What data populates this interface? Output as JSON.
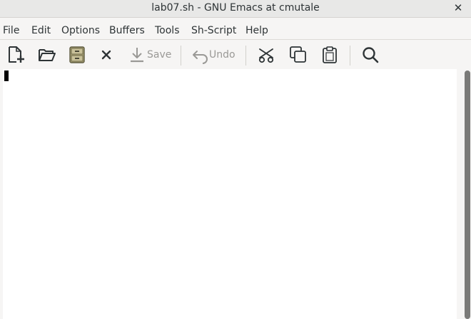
{
  "window": {
    "title": "lab07.sh - GNU Emacs at cmutale",
    "close_glyph": "✕"
  },
  "menubar": {
    "items": [
      "File",
      "Edit",
      "Options",
      "Buffers",
      "Tools",
      "Sh-Script",
      "Help"
    ]
  },
  "toolbar": {
    "new_file_icon": "new-file-icon",
    "open_icon": "folder-open-icon",
    "dired_icon": "file-cabinet-icon",
    "close_icon": "close-icon",
    "save_label": "Save",
    "undo_label": "Undo",
    "cut_icon": "scissors-icon",
    "copy_icon": "copy-icon",
    "paste_icon": "clipboard-icon",
    "search_icon": "search-icon"
  },
  "editor": {
    "content": ""
  },
  "colors": {
    "window_bg": "#f6f5f4",
    "editor_bg": "#ffffff",
    "text": "#2e3436",
    "disabled": "#9a9996",
    "cursor": "#000000",
    "scrollbar_thumb": "#7a7a78"
  }
}
